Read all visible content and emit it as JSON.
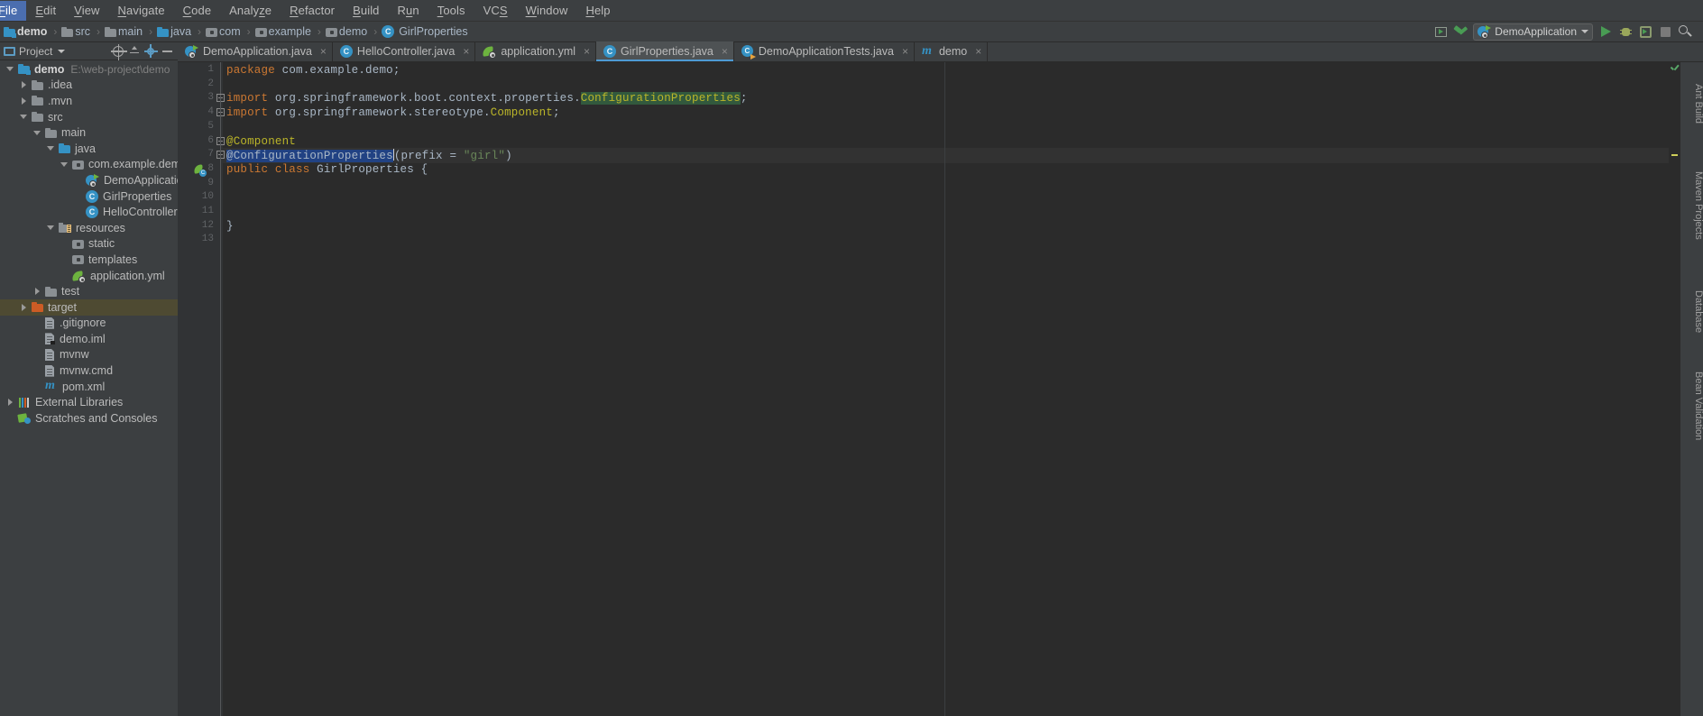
{
  "window": {
    "app": "IntelliJ IDEA",
    "theme_bg": "#3c3f41",
    "editor_bg": "#2b2b2b",
    "accent": "#4e9ad4"
  },
  "menubar": {
    "items": [
      {
        "label": "File",
        "mnemonic": "F"
      },
      {
        "label": "Edit",
        "mnemonic": "E"
      },
      {
        "label": "View",
        "mnemonic": "V"
      },
      {
        "label": "Navigate",
        "mnemonic": "N"
      },
      {
        "label": "Code",
        "mnemonic": "C"
      },
      {
        "label": "Analyze",
        "mnemonic": "z"
      },
      {
        "label": "Refactor",
        "mnemonic": "R"
      },
      {
        "label": "Build",
        "mnemonic": "B"
      },
      {
        "label": "Run",
        "mnemonic": "u"
      },
      {
        "label": "Tools",
        "mnemonic": "T"
      },
      {
        "label": "VCS",
        "mnemonic": "S"
      },
      {
        "label": "Window",
        "mnemonic": "W"
      },
      {
        "label": "Help",
        "mnemonic": "H"
      }
    ]
  },
  "breadcrumb": {
    "separator": "›",
    "items": [
      {
        "label": "demo",
        "icon": "module-folder-icon",
        "bold": true
      },
      {
        "label": "src",
        "icon": "folder-icon"
      },
      {
        "label": "main",
        "icon": "folder-icon"
      },
      {
        "label": "java",
        "icon": "source-folder-icon"
      },
      {
        "label": "com",
        "icon": "package-icon"
      },
      {
        "label": "example",
        "icon": "package-icon"
      },
      {
        "label": "demo",
        "icon": "package-icon"
      },
      {
        "label": "GirlProperties",
        "icon": "java-class-icon"
      }
    ]
  },
  "toolbar": {
    "buttons": [
      {
        "name": "run-dashboard-icon",
        "tooltip": "Run Dashboard"
      },
      {
        "name": "build-project-icon",
        "tooltip": "Build Project"
      }
    ],
    "run_config": {
      "name": "DemoApplication",
      "icon": "spring-boot-icon",
      "caret": "▾"
    },
    "actions": [
      {
        "name": "run-button",
        "tooltip": "Run"
      },
      {
        "name": "debug-button",
        "tooltip": "Debug"
      },
      {
        "name": "run-coverage-button",
        "tooltip": "Run with Coverage"
      },
      {
        "name": "stop-button",
        "tooltip": "Stop"
      },
      {
        "name": "search-everywhere-button",
        "tooltip": "Search Everywhere"
      }
    ]
  },
  "project_panel": {
    "title": "Project",
    "title_caret": "▾",
    "header_buttons": [
      {
        "name": "scroll-from-source-icon"
      },
      {
        "name": "collapse-all-icon"
      },
      {
        "name": "settings-gear-icon"
      },
      {
        "name": "hide-panel-icon"
      }
    ],
    "tree": [
      {
        "label": "demo",
        "sub": "E:\\web-project\\demo",
        "icon": "module-folder-icon",
        "depth": 0,
        "twisty": "down",
        "bold": true,
        "selected": false
      },
      {
        "label": ".idea",
        "icon": "folder-icon",
        "depth": 1,
        "twisty": "right",
        "selected": false
      },
      {
        "label": ".mvn",
        "icon": "folder-icon",
        "depth": 1,
        "twisty": "right",
        "selected": false
      },
      {
        "label": "src",
        "icon": "folder-icon",
        "depth": 1,
        "twisty": "down",
        "selected": false
      },
      {
        "label": "main",
        "icon": "folder-icon",
        "depth": 2,
        "twisty": "down",
        "selected": false
      },
      {
        "label": "java",
        "icon": "source-folder-icon",
        "depth": 3,
        "twisty": "down",
        "selected": false
      },
      {
        "label": "com.example.demo",
        "icon": "package-icon",
        "depth": 4,
        "twisty": "down",
        "selected": false
      },
      {
        "label": "DemoApplication",
        "icon": "spring-app-icon",
        "depth": 5,
        "twisty": "none",
        "selected": false
      },
      {
        "label": "GirlProperties",
        "icon": "java-class-icon",
        "depth": 5,
        "twisty": "none",
        "selected": false
      },
      {
        "label": "HelloController",
        "icon": "java-class-icon",
        "depth": 5,
        "twisty": "none",
        "selected": false
      },
      {
        "label": "resources",
        "icon": "resources-folder-icon",
        "depth": 3,
        "twisty": "down",
        "selected": false
      },
      {
        "label": "static",
        "icon": "package-icon",
        "depth": 4,
        "twisty": "none",
        "selected": false
      },
      {
        "label": "templates",
        "icon": "package-icon",
        "depth": 4,
        "twisty": "none",
        "selected": false
      },
      {
        "label": "application.yml",
        "icon": "spring-yaml-icon",
        "depth": 4,
        "twisty": "none",
        "selected": false
      },
      {
        "label": "test",
        "icon": "folder-icon",
        "depth": 2,
        "twisty": "right",
        "selected": false
      },
      {
        "label": "target",
        "icon": "target-folder-icon",
        "depth": 1,
        "twisty": "right",
        "selected": true
      },
      {
        "label": ".gitignore",
        "icon": "file-icon",
        "depth": 2,
        "twisty": "none",
        "selected": false
      },
      {
        "label": "demo.iml",
        "icon": "iml-file-icon",
        "depth": 2,
        "twisty": "none",
        "selected": false
      },
      {
        "label": "mvnw",
        "icon": "file-icon",
        "depth": 2,
        "twisty": "none",
        "selected": false
      },
      {
        "label": "mvnw.cmd",
        "icon": "file-icon",
        "depth": 2,
        "twisty": "none",
        "selected": false
      },
      {
        "label": "pom.xml",
        "icon": "maven-icon",
        "depth": 2,
        "twisty": "none",
        "selected": false
      },
      {
        "label": "External Libraries",
        "icon": "external-libraries-icon",
        "depth": 0,
        "twisty": "right",
        "selected": false
      },
      {
        "label": "Scratches and Consoles",
        "icon": "scratches-icon",
        "depth": 0,
        "twisty": "none",
        "selected": false
      }
    ]
  },
  "editor_tabs": [
    {
      "label": "DemoApplication.java",
      "icon": "spring-app-icon",
      "active": false,
      "close": "×"
    },
    {
      "label": "HelloController.java",
      "icon": "java-class-icon",
      "active": false,
      "close": "×"
    },
    {
      "label": "application.yml",
      "icon": "spring-yaml-icon",
      "active": false,
      "close": "×"
    },
    {
      "label": "GirlProperties.java",
      "icon": "java-class-icon",
      "active": true,
      "close": "×"
    },
    {
      "label": "DemoApplicationTests.java",
      "icon": "test-class-icon",
      "active": false,
      "close": "×"
    },
    {
      "label": "demo",
      "icon": "maven-icon",
      "active": false,
      "close": "×"
    }
  ],
  "editor": {
    "file": "GirlProperties.java",
    "line_numbers": [
      1,
      2,
      3,
      4,
      5,
      6,
      7,
      8,
      9,
      10,
      11,
      12,
      13
    ],
    "current_line": 7,
    "caret_line": 7,
    "gutter_icon_line": 8,
    "gutter_icon": "spring-bean-icon",
    "fold_lines": [
      3,
      4,
      6,
      7
    ],
    "lines": [
      {
        "n": 1,
        "tokens": [
          {
            "t": "package ",
            "c": "kw"
          },
          {
            "t": "com.example.demo;",
            "c": "pl"
          }
        ]
      },
      {
        "n": 2,
        "tokens": []
      },
      {
        "n": 3,
        "tokens": [
          {
            "t": "import ",
            "c": "kw"
          },
          {
            "t": "org.springframework.boot.context.properties.",
            "c": "pl"
          },
          {
            "t": "ConfigurationProperties",
            "c": "hl-green"
          },
          {
            "t": ";",
            "c": "pl"
          }
        ]
      },
      {
        "n": 4,
        "tokens": [
          {
            "t": "import ",
            "c": "kw"
          },
          {
            "t": "org.springframework.stereotype.",
            "c": "pl"
          },
          {
            "t": "Component",
            "c": "ann"
          },
          {
            "t": ";",
            "c": "pl"
          }
        ]
      },
      {
        "n": 5,
        "tokens": []
      },
      {
        "n": 6,
        "tokens": [
          {
            "t": "@Component",
            "c": "ann"
          }
        ]
      },
      {
        "n": 7,
        "tokens": [
          {
            "t": "@ConfigurationProperties",
            "c": "hl-sel"
          },
          {
            "t": "|",
            "c": "caret"
          },
          {
            "t": "(prefix = ",
            "c": "pl"
          },
          {
            "t": "\"girl\"",
            "c": "str"
          },
          {
            "t": ")",
            "c": "pl"
          }
        ]
      },
      {
        "n": 8,
        "tokens": [
          {
            "t": "public class ",
            "c": "kw"
          },
          {
            "t": "GirlProperties {",
            "c": "pl"
          }
        ]
      },
      {
        "n": 9,
        "tokens": []
      },
      {
        "n": 10,
        "tokens": []
      },
      {
        "n": 11,
        "tokens": []
      },
      {
        "n": 12,
        "tokens": [
          {
            "t": "}",
            "c": "pl"
          }
        ]
      },
      {
        "n": 13,
        "tokens": []
      }
    ],
    "inspection_status": "ok",
    "inspection_marks": 1
  },
  "right_tool_windows": [
    {
      "label": "Ant Build",
      "icon": "ant-icon"
    },
    {
      "label": "Maven Projects",
      "icon": "maven-icon"
    },
    {
      "label": "Database",
      "icon": "database-icon"
    },
    {
      "label": "Bean Validation",
      "icon": "bean-validation-icon"
    }
  ]
}
